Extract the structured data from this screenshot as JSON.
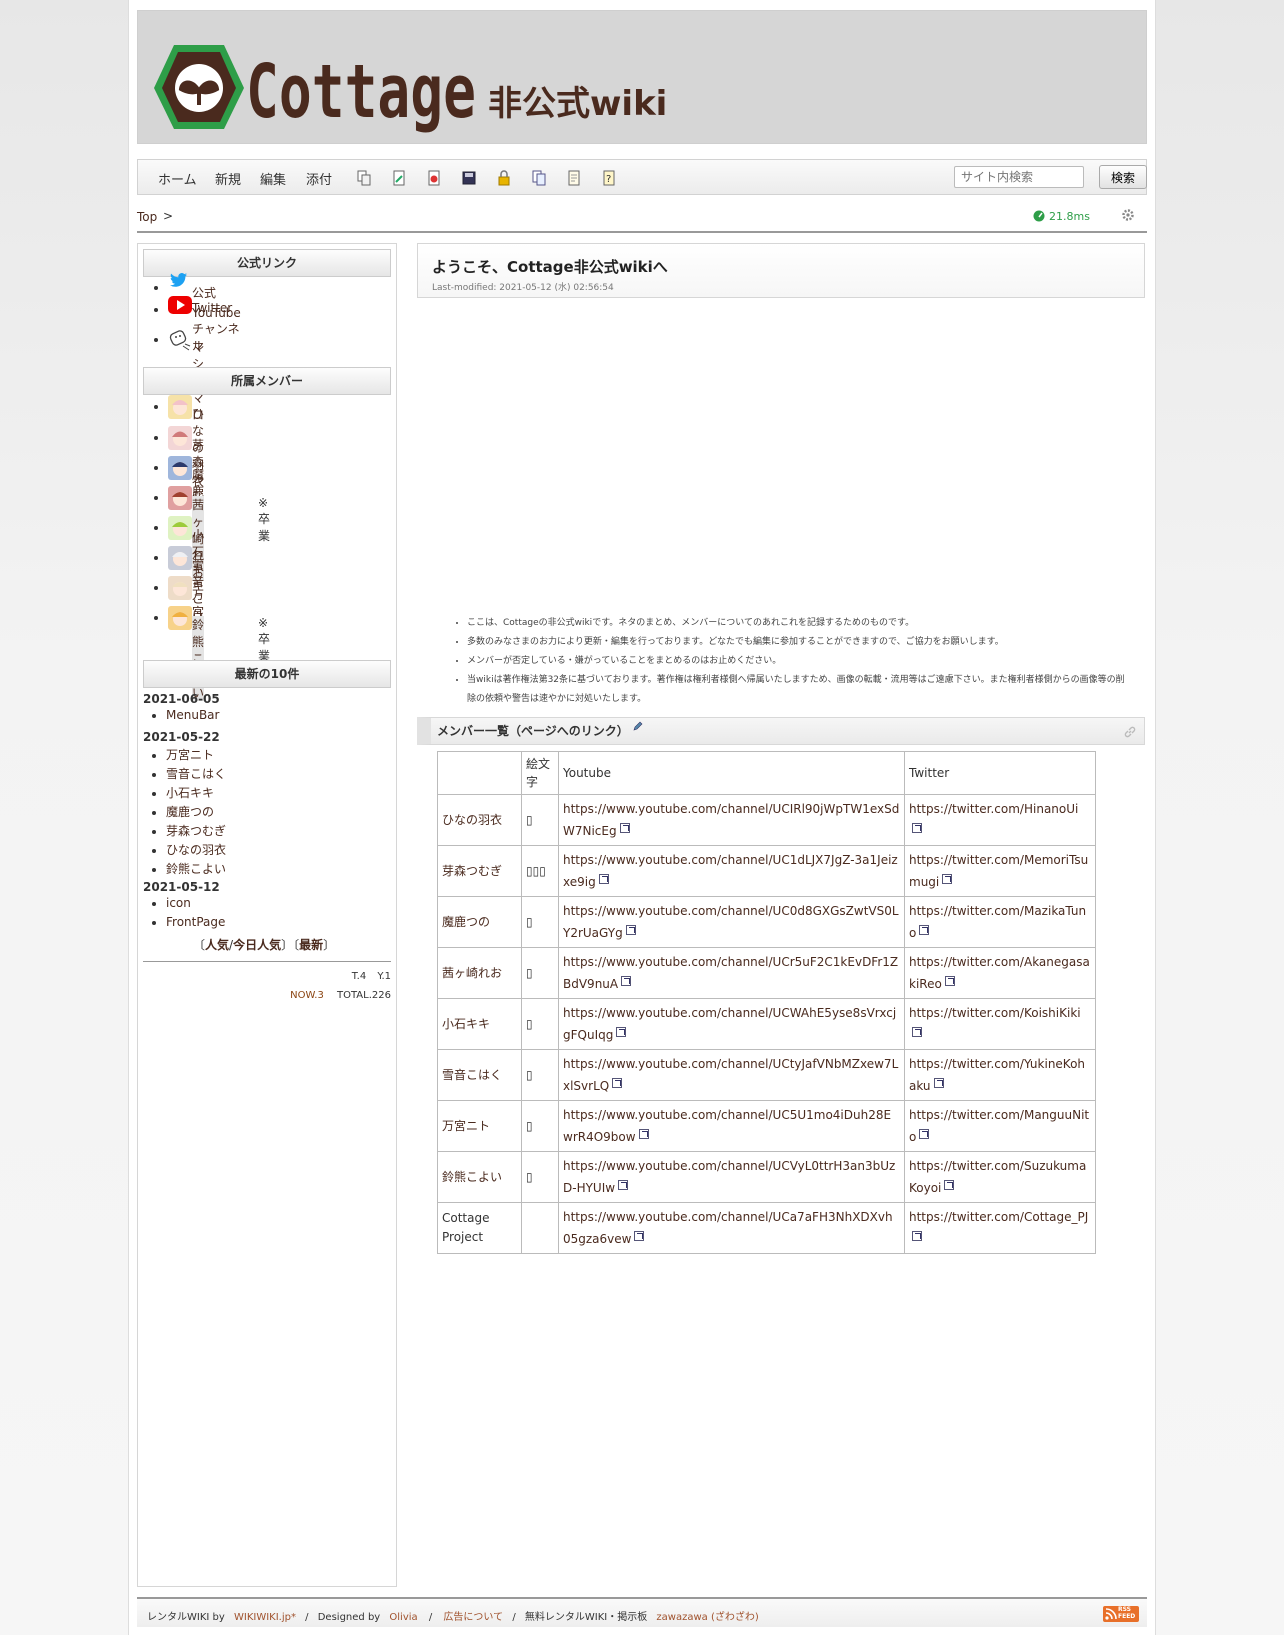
{
  "header": {
    "logo_text": "Cottage",
    "logo_subtitle": "非公式wiki"
  },
  "nav": {
    "items": [
      "ホーム",
      "新規",
      "編集",
      "添付"
    ],
    "tool_icons": [
      "copy-icon",
      "rename-icon",
      "diff-icon",
      "backup-icon",
      "freeze-icon",
      "list-icon",
      "recent-icon",
      "help-icon"
    ],
    "search_placeholder": "サイト内検索",
    "search_button": "検索"
  },
  "breadcrumb": {
    "top": "Top",
    "sep": ">",
    "timing": "21.8ms"
  },
  "sidebar": {
    "official_title": "公式リンク",
    "official_links": [
      {
        "icon": "twitter-icon",
        "label": "公式Twitter"
      },
      {
        "icon": "youtube-icon",
        "label": "YouTubeチャンネル"
      },
      {
        "icon": "marshmallow-icon",
        "label": "マシュマロ"
      }
    ],
    "members_title": "所属メンバー",
    "members": [
      {
        "name": "ひなの羽衣",
        "note": ""
      },
      {
        "name": "芽森つむぎ",
        "note": ""
      },
      {
        "name": "魔鹿つの",
        "note": ""
      },
      {
        "name": "茜ヶ崎れお",
        "note": "※卒業"
      },
      {
        "name": "小石キキ",
        "note": ""
      },
      {
        "name": "雪音こはく",
        "note": ""
      },
      {
        "name": "万宮ニト",
        "note": ""
      },
      {
        "name": "鈴熊こよい",
        "note": "※卒業"
      }
    ],
    "recent_title": "最新の10件",
    "recent": [
      {
        "date": "2021-06-05",
        "pages": [
          "MenuBar"
        ]
      },
      {
        "date": "2021-05-22",
        "pages": [
          "万宮ニト",
          "雪音こはく",
          "小石キキ",
          "魔鹿つの",
          "芽森つむぎ",
          "ひなの羽衣",
          "鈴熊こよい"
        ]
      },
      {
        "date": "2021-05-12",
        "pages": [
          "icon",
          "FrontPage"
        ]
      }
    ],
    "ranking": {
      "open": "〔",
      "popular": "人気",
      "slash": "/",
      "today": "今日人気",
      "close": "〕",
      "open2": "〔",
      "latest": "最新",
      "close2": "〕"
    },
    "counter": {
      "t": "T.4",
      "y": "Y.1",
      "now": "NOW.3",
      "total": "TOTAL.226"
    }
  },
  "main": {
    "title": "ようこそ、Cottage非公式wikiへ",
    "last_modified": "Last-modified: 2021-05-12 (水) 02:56:54",
    "notes": [
      "ここは、Cottageの非公式wikiです。ネタのまとめ、メンバーについてのあれこれを記録するためのものです。",
      "多数のみなさまのお力により更新・編集を行っております。どなたでも編集に参加することができますので、ご協力をお願いします。",
      "メンバーが否定している・嫌がっていることをまとめるのはお止めください。",
      "当wikiは著作権法第32条に基づいております。著作権は権利者様側へ帰属いたしますため、画像の転載・流用等はご遠慮下さい。また権利者様側からの画像等の削除の依頼や警告は速やかに対処いたします。"
    ],
    "section_title": "メンバー一覧（ページへのリンク）",
    "table": {
      "headers": [
        "",
        "絵文字",
        "Youtube",
        "Twitter"
      ],
      "rows": [
        {
          "name": "ひなの羽衣",
          "emoji": "▯",
          "youtube": "https://www.youtube.com/channel/UCIRl90jWpTW1exSdW7NicEg",
          "twitter": "https://twitter.com/HinanoUi"
        },
        {
          "name": "芽森つむぎ",
          "emoji": "▯▯▯",
          "youtube": "https://www.youtube.com/channel/UC1dLJX7JgZ-3a1Jeizxe9ig",
          "twitter": "https://twitter.com/MemoriTsumugi"
        },
        {
          "name": "魔鹿つの",
          "emoji": "▯",
          "youtube": "https://www.youtube.com/channel/UC0d8GXGsZwtVS0LY2rUaGYg",
          "twitter": "https://twitter.com/MazikaTuno"
        },
        {
          "name": "茜ヶ崎れお",
          "emoji": "▯",
          "youtube": "https://www.youtube.com/channel/UCr5uF2C1kEvDFr1ZBdV9nuA",
          "twitter": "https://twitter.com/AkanegasakiReo"
        },
        {
          "name": "小石キキ",
          "emoji": "▯",
          "youtube": "https://www.youtube.com/channel/UCWAhE5yse8sVrxcjgFQuIqg",
          "twitter": "https://twitter.com/KoishiKiki"
        },
        {
          "name": "雪音こはく",
          "emoji": "▯",
          "youtube": "https://www.youtube.com/channel/UCtyJafVNbMZxew7LxlSvrLQ",
          "twitter": "https://twitter.com/YukineKohaku"
        },
        {
          "name": "万宮ニト",
          "emoji": "▯",
          "youtube": "https://www.youtube.com/channel/UC5U1mo4iDuh28EwrR4O9bow",
          "twitter": "https://twitter.com/ManguuNito"
        },
        {
          "name": "鈴熊こよい",
          "emoji": "▯",
          "youtube": "https://www.youtube.com/channel/UCVyL0ttrH3an3bUzD-HYUIw",
          "twitter": "https://twitter.com/SuzukumaKoyoi"
        },
        {
          "name": "Cottage Project",
          "emoji": "",
          "youtube": "https://www.youtube.com/channel/UCa7aFH3NhXDXvh05gza6vew",
          "twitter": "https://twitter.com/Cottage_PJ"
        }
      ]
    }
  },
  "footer": {
    "prefix": "レンタルWIKI by",
    "wikiwiki": "WIKIWIKI.jp*",
    "sep1": "/",
    "designed_by": "Designed by",
    "olivia": "Olivia",
    "sep2": "/",
    "ad": "広告について",
    "sep3": "/",
    "free": "無料レンタルWIKI・掲示板",
    "zawazawa": "zawazawa (ざわざわ)",
    "rss_top": "RSS",
    "rss_bottom": "FEED"
  },
  "colors": {
    "brand_brown": "#4a2a1e",
    "brand_green": "#2e9e48",
    "timing_green": "#2e9e48",
    "link": "#4a2a1e",
    "footer_link": "#a0522d"
  }
}
